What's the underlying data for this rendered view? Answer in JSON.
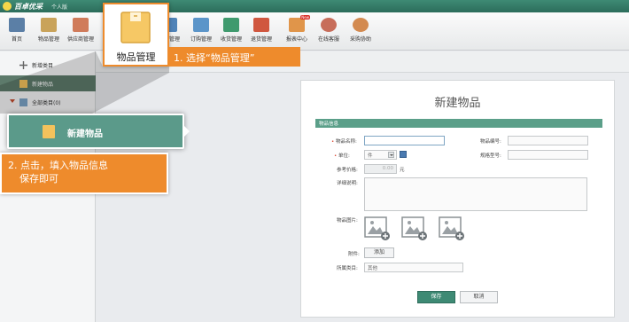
{
  "app": {
    "title": "百卓优采",
    "edition": "个人版"
  },
  "toolbar": [
    {
      "label": "首页",
      "icon": "home-icon",
      "color": "#5b7fa6"
    },
    {
      "label": "物品管理",
      "icon": "box-icon",
      "color": "#c9a35a"
    },
    {
      "label": "供应商管理",
      "icon": "supplier-icon",
      "color": "#d07b5a"
    },
    {
      "label": "采购管理",
      "icon": "purchase-icon",
      "color": "#4f83b8"
    },
    {
      "label": "订购管理",
      "icon": "order-icon",
      "color": "#5b95c9"
    },
    {
      "label": "收货管理",
      "icon": "receive-icon",
      "color": "#3f9a6e"
    },
    {
      "label": "退货管理",
      "icon": "return-icon",
      "color": "#d0573f"
    },
    {
      "label": "报表中心",
      "icon": "report-chart-icon",
      "color": "#e0954a",
      "badge": "New"
    },
    {
      "label": "在线客服",
      "icon": "service-icon",
      "color": "#c76d5a"
    },
    {
      "label": "采购协助",
      "icon": "assist-icon",
      "color": "#d38a50"
    }
  ],
  "sidebar": [
    {
      "label": "新增类目"
    },
    {
      "label": "新建物品"
    },
    {
      "label": "全部类目(0)"
    }
  ],
  "form": {
    "title": "新建物品",
    "section": "物品信息",
    "name_label": "物品名称:",
    "code_label": "物品编号:",
    "unit_label": "单位:",
    "unit_value": "件",
    "spec_label": "规格型号:",
    "price_label": "参考价格:",
    "price_value": "0.00",
    "price_unit": "元",
    "desc_label": "详细说明:",
    "image_label": "物品图片:",
    "attach_label": "附件:",
    "attach_button": "添加",
    "category_label": "所属类目:",
    "category_value": "其他",
    "save_button": "保存",
    "cancel_button": "取消"
  },
  "callouts": {
    "toolbar_label": "物品管理",
    "step1": "1. 选择“物品管理”",
    "nav_label": "新建物品",
    "step2_line1": "2. 点击，填入物品信息",
    "step2_line2": "保存即可"
  },
  "colors": {
    "accent": "#3e8a74",
    "highlight": "#ee8b2c"
  }
}
